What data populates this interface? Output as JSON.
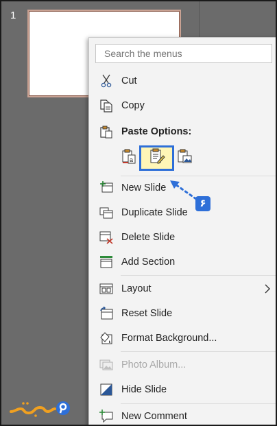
{
  "slide_panel": {
    "slide_number": "1"
  },
  "menu": {
    "search_placeholder": "Search the menus",
    "items": [
      {
        "label": "Cut",
        "icon": "scissors-icon"
      },
      {
        "label": "Copy",
        "icon": "copy-icon"
      },
      {
        "label": "Paste Options:",
        "icon": "paste-icon"
      },
      {
        "label": "New Slide",
        "icon": "new-slide-icon"
      },
      {
        "label": "Duplicate Slide",
        "icon": "duplicate-slide-icon"
      },
      {
        "label": "Delete Slide",
        "icon": "delete-slide-icon"
      },
      {
        "label": "Add Section",
        "icon": "add-section-icon"
      },
      {
        "label": "Layout",
        "icon": "layout-icon"
      },
      {
        "label": "Reset Slide",
        "icon": "reset-slide-icon"
      },
      {
        "label": "Format Background...",
        "icon": "format-background-icon"
      },
      {
        "label": "Photo Album...",
        "icon": "photo-album-icon",
        "disabled": true
      },
      {
        "label": "Hide Slide",
        "icon": "hide-slide-icon"
      },
      {
        "label": "New Comment",
        "icon": "new-comment-icon"
      }
    ],
    "paste_options": [
      {
        "name": "use-destination-theme",
        "icon": "paste-destination-theme-icon"
      },
      {
        "name": "keep-source-formatting",
        "icon": "paste-keep-source-icon",
        "selected": true
      },
      {
        "name": "picture",
        "icon": "paste-picture-icon"
      }
    ]
  },
  "annotation": {
    "step_badge": "۶"
  },
  "colors": {
    "highlight_border": "#2e6fd8",
    "highlight_fill": "#fff6b7",
    "badge": "#2e6fd8"
  }
}
